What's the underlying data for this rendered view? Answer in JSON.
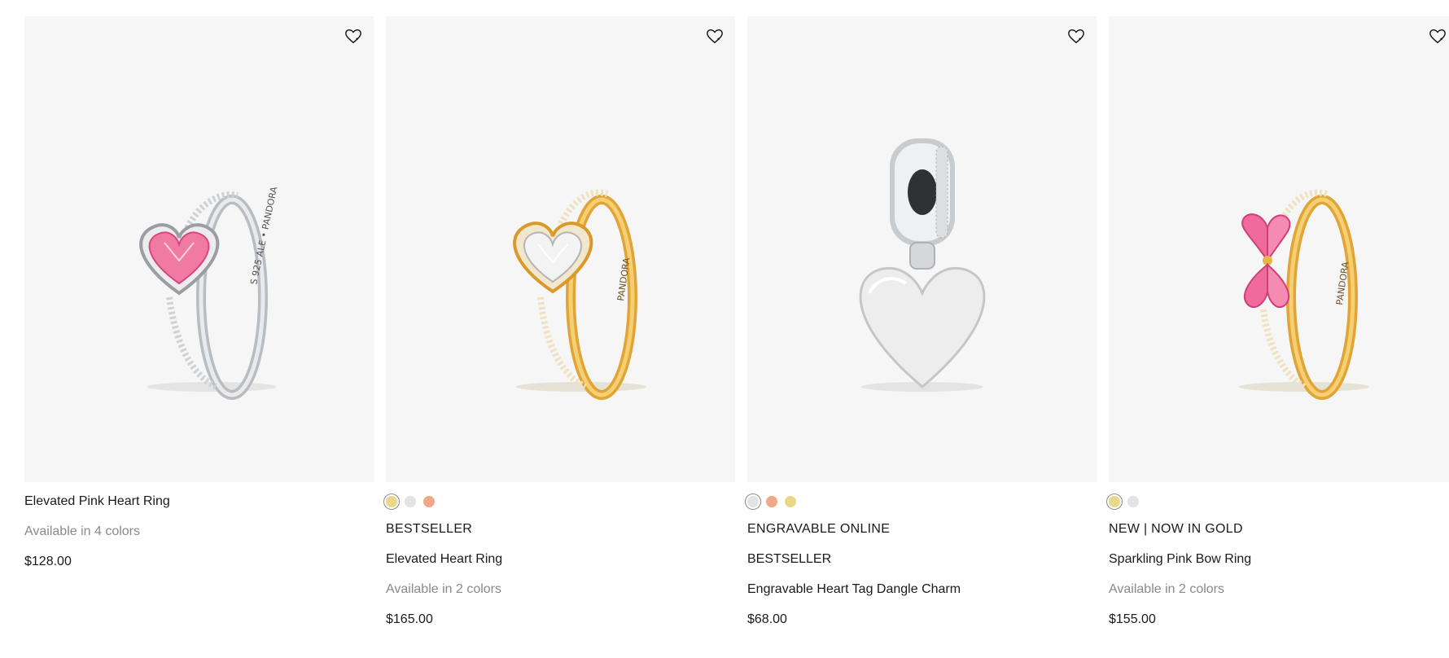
{
  "products": [
    {
      "name": "Elevated Pink Heart Ring",
      "availability": "Available in 4 colors",
      "price": "$128.00",
      "image_icon": "silver-pink-heart-ring",
      "ring_text": "S 925 ALE  •  PANDORA"
    },
    {
      "swatches": [
        "#e8d98a",
        "#e3e3e3",
        "#f2a887"
      ],
      "tags": [
        "BESTSELLER"
      ],
      "name": "Elevated Heart Ring",
      "availability": "Available in 2 colors",
      "price": "$165.00",
      "image_icon": "gold-clear-heart-ring",
      "ring_text": "PANDORA"
    },
    {
      "swatches": [
        "#e3e3e3",
        "#f2a887",
        "#e8d98a"
      ],
      "tags": [
        "ENGRAVABLE ONLINE",
        "BESTSELLER"
      ],
      "name": "Engravable Heart Tag Dangle Charm",
      "price": "$68.00",
      "image_icon": "silver-heart-tag-charm"
    },
    {
      "swatches": [
        "#e8d98a",
        "#e3e3e3"
      ],
      "tags": [
        "NEW | NOW IN GOLD"
      ],
      "name": "Sparkling Pink Bow Ring",
      "availability": "Available in 2 colors",
      "price": "$155.00",
      "image_icon": "gold-pink-bow-ring",
      "ring_text": "PANDORA"
    }
  ],
  "wishlist_icon": "heart-outline-icon"
}
